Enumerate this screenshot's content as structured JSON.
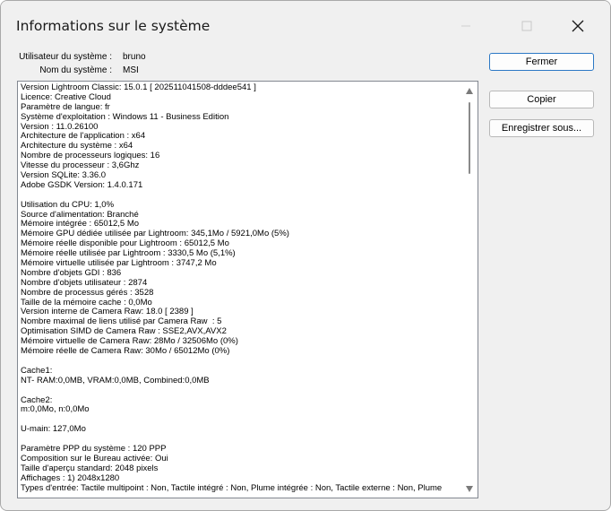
{
  "window": {
    "title": "Informations sur le système",
    "controls": [
      "minimize-icon",
      "maximize-icon",
      "close-icon"
    ]
  },
  "system": {
    "user_label": "Utilisateur du système :",
    "user_value": "bruno",
    "name_label": "Nom du système :",
    "name_value": "MSI"
  },
  "buttons": {
    "close": "Fermer",
    "copy": "Copier",
    "save_as": "Enregistrer sous..."
  },
  "info_lines": [
    "Version Lightroom Classic: 15.0.1 [ 202511041508-dddee541 ]",
    "Licence: Creative Cloud",
    "Paramètre de langue: fr",
    "Système d'exploitation : Windows 11 - Business Edition",
    "Version : 11.0.26100",
    "Architecture de l'application : x64",
    "Architecture du système : x64",
    "Nombre de processeurs logiques: 16",
    "Vitesse du processeur : 3,6Ghz",
    "Version SQLite: 3.36.0",
    "Adobe GSDK Version: 1.4.0.171",
    "",
    "Utilisation du CPU: 1,0%",
    "Source d'alimentation: Branché",
    "Mémoire intégrée : 65012,5 Mo",
    "Mémoire GPU dédiée utilisée par Lightroom: 345,1Mo / 5921,0Mo (5%)",
    "Mémoire réelle disponible pour Lightroom : 65012,5 Mo",
    "Mémoire réelle utilisée par Lightroom : 3330,5 Mo (5,1%)",
    "Mémoire virtuelle utilisée par Lightroom : 3747,2 Mo",
    "Nombre d'objets GDI : 836",
    "Nombre d'objets utilisateur : 2874",
    "Nombre de processus gérés : 3528",
    "Taille de la mémoire cache : 0,0Mo",
    "Version interne de Camera Raw: 18.0 [ 2389 ]",
    "Nombre maximal de liens utilisé par Camera Raw  : 5",
    "Optimisation SIMD de Camera Raw : SSE2,AVX,AVX2",
    "Mémoire virtuelle de Camera Raw: 28Mo / 32506Mo (0%)",
    "Mémoire réelle de Camera Raw: 30Mo / 65012Mo (0%)",
    "",
    "Cache1:",
    "NT- RAM:0,0MB, VRAM:0,0MB, Combined:0,0MB",
    "",
    "Cache2:",
    "m:0,0Mo, n:0,0Mo",
    "",
    "U-main: 127,0Mo",
    "",
    "Paramètre PPP du système : 120 PPP",
    "Composition sur le Bureau activée: Oui",
    "Taille d'aperçu standard: 2048 pixels",
    "Affichages : 1) 2048x1280",
    "Types d'entrée: Tactile multipoint : Non, Tactile intégré : Non, Plume intégrée : Non, Tactile externe : Non, Plume"
  ]
}
